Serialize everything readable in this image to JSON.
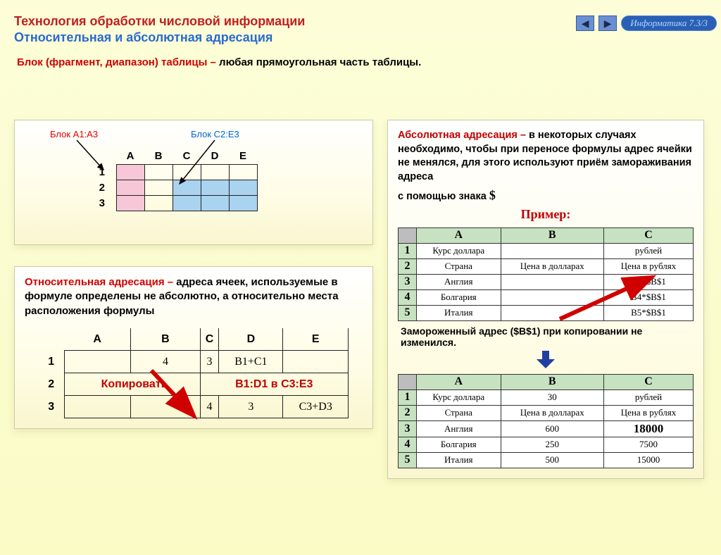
{
  "nav": {
    "badge": "Информатика  7.3/3"
  },
  "header": {
    "line1": "Технология обработки числовой информации",
    "line2": "Относительная и абсолютная адресация"
  },
  "defn": {
    "term": "Блок (фрагмент, диапазон) таблицы –",
    "rest": " любая прямоугольная часть таблицы."
  },
  "left": {
    "label_a1a3": "Блок A1:A3",
    "label_c2e3": "Блок C2:E3",
    "grid1": {
      "cols": [
        "A",
        "B",
        "C",
        "D",
        "E"
      ],
      "rows": [
        "1",
        "2",
        "3"
      ]
    },
    "rel_term": "Относительная адресация –",
    "rel_rest": " адреса ячеек, используемые в формуле определены не абсолютно, а относительно места расположения формулы",
    "grid2": {
      "cols": [
        "A",
        "B",
        "C",
        "D",
        "E"
      ],
      "rows": [
        "1",
        "2",
        "3"
      ],
      "r1": [
        "",
        "4",
        "3",
        "B1+C1",
        ""
      ],
      "r2_copy": "Копировать",
      "r2_range": "B1:D1 в C3:E3",
      "r3": [
        "",
        "",
        "4",
        "3",
        "C3+D3"
      ]
    }
  },
  "right": {
    "abs_term": "Абсолютная адресация –",
    "abs_rest": " в некоторых случаях необходимо, чтобы при переносе формулы адрес ячейки не менялся, для этого используют приём замораживания адреса",
    "abs_tail": "с помощью знака ",
    "dollar": "$",
    "example": "Пример:",
    "sheet1": {
      "cols": [
        "A",
        "B",
        "C"
      ],
      "rows": [
        [
          "1",
          "Курс доллара",
          "",
          "рублей"
        ],
        [
          "2",
          "Страна",
          "Цена в долларах",
          "Цена в рублях"
        ],
        [
          "3",
          "Англия",
          "",
          "B3*$B$1"
        ],
        [
          "4",
          "Болгария",
          "",
          "B4*$B$1"
        ],
        [
          "5",
          "Италия",
          "",
          "B5*$B$1"
        ]
      ]
    },
    "frozen": "Замороженный адрес ($B$1) при копировании не изменился.",
    "sheet2": {
      "cols": [
        "A",
        "B",
        "C"
      ],
      "rows": [
        [
          "1",
          "Курс доллара",
          "30",
          "рублей"
        ],
        [
          "2",
          "Страна",
          "Цена в долларах",
          "Цена в рублях"
        ],
        [
          "3",
          "Англия",
          "600",
          "18000"
        ],
        [
          "4",
          "Болгария",
          "250",
          "7500"
        ],
        [
          "5",
          "Италия",
          "500",
          "15000"
        ]
      ]
    }
  }
}
